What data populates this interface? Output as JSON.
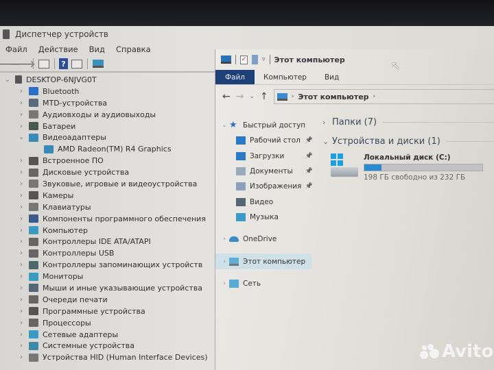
{
  "device_manager": {
    "title": "Диспетчер устройств",
    "menu": [
      "Файл",
      "Действие",
      "Вид",
      "Справка"
    ],
    "toolbar": [
      "back-icon",
      "forward-icon",
      "properties-icon",
      "help-icon",
      "update-icon",
      "monitor-icon"
    ],
    "root": "DESKTOP-6NJVG0T",
    "tree": [
      {
        "label": "Bluetooth",
        "icon": "bluetooth-icon",
        "color": "#2a6fc8",
        "expanded": false
      },
      {
        "label": "MTD-устройства",
        "icon": "mtd-icon",
        "color": "#5a6a7a",
        "expanded": false
      },
      {
        "label": "Аудиовходы и аудиовыходы",
        "icon": "speaker-icon",
        "color": "#777777",
        "expanded": false
      },
      {
        "label": "Батареи",
        "icon": "battery-icon",
        "color": "#4a5a4a",
        "expanded": false
      },
      {
        "label": "Видеоадаптеры",
        "icon": "display-adapter-icon",
        "color": "#3a8ab8",
        "expanded": true
      },
      {
        "label": "AMD Radeon(TM) R4 Graphics",
        "icon": "display-adapter-icon",
        "color": "#3a8ab8",
        "child": true
      },
      {
        "label": "Встроенное ПО",
        "icon": "firmware-icon",
        "color": "#555555",
        "expanded": false
      },
      {
        "label": "Дисковые устройства",
        "icon": "disk-icon",
        "color": "#666666",
        "expanded": false
      },
      {
        "label": "Звуковые, игровые и видеоустройства",
        "icon": "sound-icon",
        "color": "#777777",
        "expanded": false
      },
      {
        "label": "Камеры",
        "icon": "camera-icon",
        "color": "#555555",
        "expanded": false
      },
      {
        "label": "Клавиатуры",
        "icon": "keyboard-icon",
        "color": "#777777",
        "expanded": false
      },
      {
        "label": "Компоненты программного обеспечения",
        "icon": "software-component-icon",
        "color": "#3a5a8a",
        "expanded": false
      },
      {
        "label": "Компьютер",
        "icon": "computer-icon",
        "color": "#3a9ac0",
        "expanded": false
      },
      {
        "label": "Контроллеры IDE ATA/ATAPI",
        "icon": "ide-controller-icon",
        "color": "#666666",
        "expanded": false
      },
      {
        "label": "Контроллеры USB",
        "icon": "usb-icon",
        "color": "#666666",
        "expanded": false
      },
      {
        "label": "Контроллеры запоминающих устройств",
        "icon": "storage-controller-icon",
        "color": "#4a6a6a",
        "expanded": false
      },
      {
        "label": "Мониторы",
        "icon": "monitor-icon",
        "color": "#3a9ac0",
        "expanded": false
      },
      {
        "label": "Мыши и иные указывающие устройства",
        "icon": "mouse-icon",
        "color": "#556677",
        "expanded": false
      },
      {
        "label": "Очереди печати",
        "icon": "printer-icon",
        "color": "#666666",
        "expanded": false
      },
      {
        "label": "Программные устройства",
        "icon": "software-device-icon",
        "color": "#555555",
        "expanded": false
      },
      {
        "label": "Процессоры",
        "icon": "cpu-icon",
        "color": "#666666",
        "expanded": false
      },
      {
        "label": "Сетевые адаптеры",
        "icon": "network-adapter-icon",
        "color": "#3a9ac0",
        "expanded": false
      },
      {
        "label": "Системные устройства",
        "icon": "system-device-icon",
        "color": "#3a8aa8",
        "expanded": false
      },
      {
        "label": "Устройства HID (Human Interface Devices)",
        "icon": "hid-icon",
        "color": "#777777",
        "expanded": false
      }
    ]
  },
  "explorer": {
    "title": "Этот компьютер",
    "ribbon_tabs": [
      "Файл",
      "Компьютер",
      "Вид"
    ],
    "address": {
      "crumbs": [
        "Этот компьютер"
      ]
    },
    "nav_pane": {
      "quick_access": {
        "label": "Быстрый доступ",
        "items": [
          {
            "label": "Рабочий стол",
            "icon": "desktop-folder-icon",
            "pinned": true,
            "color": "#2a7ac8"
          },
          {
            "label": "Загрузки",
            "icon": "downloads-icon",
            "pinned": true,
            "color": "#2a7ac8"
          },
          {
            "label": "Документы",
            "icon": "documents-icon",
            "pinned": true,
            "color": "#9aaabb"
          },
          {
            "label": "Изображения",
            "icon": "pictures-icon",
            "pinned": true,
            "color": "#8aa0b8"
          },
          {
            "label": "Видео",
            "icon": "videos-icon",
            "pinned": false,
            "color": "#556677"
          },
          {
            "label": "Музыка",
            "icon": "music-icon",
            "pinned": false,
            "color": "#3a9ac8"
          }
        ]
      },
      "onedrive": "OneDrive",
      "this_pc": "Этот компьютер",
      "network": "Сеть"
    },
    "groups": {
      "folders": "Папки (7)",
      "devices": "Устройства и диски (1)"
    },
    "drive": {
      "name": "Локальный диск (C:)",
      "free_text": "198 ГБ свободно из 232 ГБ",
      "used_fraction": 0.147,
      "bar_color": "#2a8ad0"
    }
  },
  "watermark": {
    "text": "Avito"
  }
}
